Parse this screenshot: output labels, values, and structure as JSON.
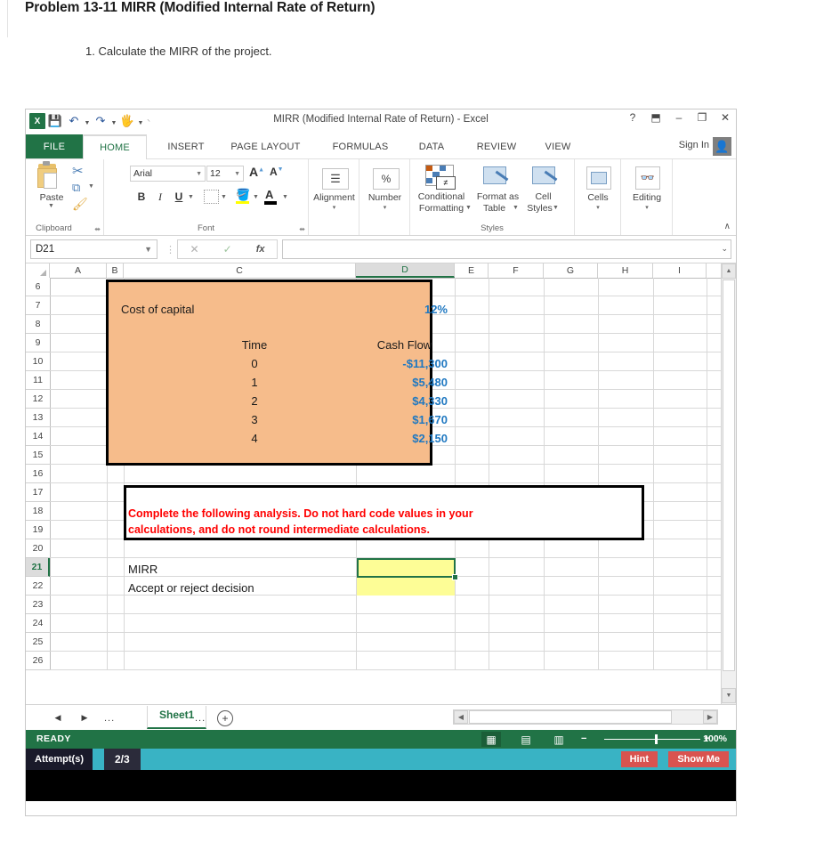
{
  "page": {
    "problem_title": "Problem 13-11 MIRR (Modified Internal Rate of Return)",
    "question": "1. Calculate the MIRR of the project."
  },
  "window": {
    "title": "MIRR (Modified Internal Rate of Return) - Excel",
    "logo": "excel-logo",
    "help": "?",
    "ribbon_display": "⬒",
    "minimize": "–",
    "restore": "❐",
    "close": "✕",
    "sign_in": "Sign In",
    "avatar": "👤",
    "quick_access": [
      {
        "name": "save-icon",
        "glyph": "💾"
      },
      {
        "name": "undo-icon",
        "glyph": "↶"
      },
      {
        "name": "redo-icon",
        "glyph": "↷"
      },
      {
        "name": "touch-mode-icon",
        "glyph": "🖊"
      },
      {
        "name": "customize-qat-icon",
        "glyph": "⸌"
      }
    ]
  },
  "ribbon": {
    "file_tab": "FILE",
    "tabs": [
      {
        "label": "HOME",
        "active": true
      },
      {
        "label": "INSERT",
        "active": false
      },
      {
        "label": "PAGE LAYOUT",
        "active": false
      },
      {
        "label": "FORMULAS",
        "active": false
      },
      {
        "label": "DATA",
        "active": false
      },
      {
        "label": "REVIEW",
        "active": false
      },
      {
        "label": "VIEW",
        "active": false
      }
    ],
    "collapse_glyph": "∧",
    "groups": {
      "clipboard": {
        "label": "Clipboard",
        "paste": "Paste",
        "cut_icon": "✂",
        "copy_icon": "⧉",
        "format_painter_icon": "🖌",
        "launcher": "⬌"
      },
      "font": {
        "label": "Font",
        "font_name": "Arial",
        "font_size": "12",
        "grow_font": "A",
        "shrink_font": "A",
        "bold": "B",
        "italic": "I",
        "underline": "U",
        "borders_icon": "▦",
        "fill_color_icon": "🪣",
        "font_color_icon": "A",
        "launcher": "⬌"
      },
      "alignment": {
        "label": "Alignment",
        "icon": "☰",
        "caret": "▾"
      },
      "number": {
        "label": "Number",
        "icon": "%",
        "caret": "▾"
      },
      "styles": {
        "label": "Styles",
        "conditional_formatting": "Conditional\nFormatting",
        "conditional_formatting_l1": "Conditional",
        "conditional_formatting_l2": "Formatting",
        "format_as_table_l1": "Format as",
        "format_as_table_l2": "Table",
        "cell_styles_l1": "Cell",
        "cell_styles_l2": "Styles"
      },
      "cells": {
        "label": "Cells",
        "caret": "▾"
      },
      "editing": {
        "label": "Editing",
        "icon": "♟",
        "caret": "▾"
      }
    }
  },
  "formula_bar": {
    "name_box": "D21",
    "cancel_icon": "✕",
    "enter_icon": "✓",
    "function_icon": "fx",
    "formula_value": "",
    "expand_caret": "⌄"
  },
  "grid": {
    "columns": [
      "A",
      "B",
      "C",
      "D",
      "E",
      "F",
      "G",
      "H",
      "I"
    ],
    "selected_column": "D",
    "rows": [
      "6",
      "7",
      "8",
      "9",
      "10",
      "11",
      "12",
      "13",
      "14",
      "15",
      "16",
      "17",
      "18",
      "19",
      "20",
      "21",
      "22",
      "23",
      "24",
      "25",
      "26"
    ],
    "selected_row": "21",
    "cells": {
      "cost_of_capital_label": "Cost of capital",
      "cost_of_capital_value": "12%",
      "time_header": "Time",
      "cash_flow_header": "Cash Flow",
      "time_values": [
        "0",
        "1",
        "2",
        "3",
        "4"
      ],
      "cash_flow_values": [
        "-$11,300",
        "$5,480",
        "$4,330",
        "$1,670",
        "$2,150"
      ],
      "instruction_line1": "Complete the following analysis. Do not hard code values in your",
      "instruction_line2": "calculations, and do not round intermediate calculations.",
      "mirr_label": "MIRR",
      "mirr_value": "",
      "decision_label": "Accept or reject decision",
      "decision_value": ""
    },
    "colors": {
      "data_block_fill": "#F6BC8B",
      "input_cell_fill": "#FDFD96",
      "instruction_text": "#FF0000",
      "value_text": "#1F78C1",
      "selection": "#217346"
    },
    "scroll_up_icon": "▲",
    "scroll_down_icon": "▼"
  },
  "sheet_bar": {
    "first_icon": "◀",
    "last_icon": "▶",
    "left_ellipsis": "...",
    "right_ellipsis": "...",
    "sheets": [
      "Sheet1"
    ],
    "active_sheet": "Sheet1",
    "new_sheet_icon": "+",
    "hscroll_left": "◀",
    "hscroll_right": "▶"
  },
  "status_bar": {
    "state": "READY",
    "views": [
      {
        "name": "normal-view-icon",
        "glyph": "▦",
        "active": true
      },
      {
        "name": "page-layout-view-icon",
        "glyph": "▤",
        "active": false
      },
      {
        "name": "page-break-preview-icon",
        "glyph": "▥",
        "active": false
      }
    ],
    "zoom_out": "−",
    "zoom_in": "+",
    "zoom_level": "100%"
  },
  "attempt_bar": {
    "label": "Attempt(s)",
    "count": "2/3",
    "hint_button": "Hint",
    "show_me_button": "Show Me"
  }
}
